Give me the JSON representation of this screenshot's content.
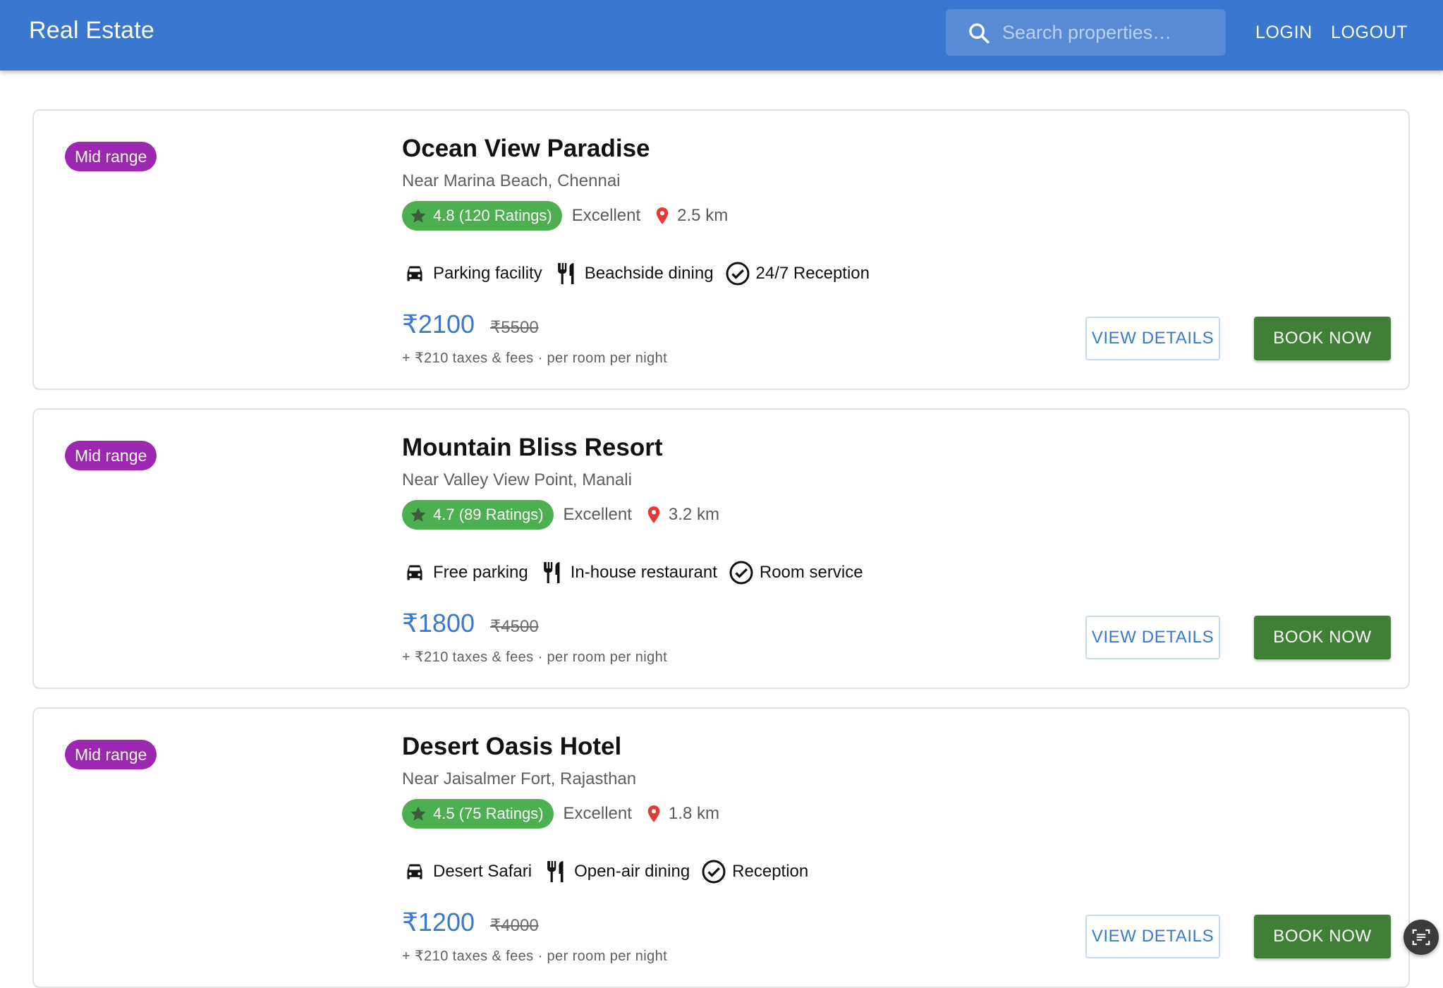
{
  "appbar": {
    "brand": "Real Estate",
    "search_placeholder": "Search properties…",
    "login_label": "LOGIN",
    "logout_label": "LOGOUT"
  },
  "colors": {
    "appbar": "#3a77cf",
    "tag": "#9c27b0",
    "rating": "#4caf50",
    "price": "#3a77cf",
    "book_button": "#3f7f36",
    "pin": "#e53935"
  },
  "listings": [
    {
      "tag": "Mid range",
      "name": "Ocean View Paradise",
      "address": "Near Marina Beach, Chennai",
      "rating": "4.8 (120 Ratings)",
      "quality": "Excellent",
      "distance": "2.5 km",
      "amenities": [
        {
          "icon": "car-icon",
          "label": "Parking facility"
        },
        {
          "icon": "restaurant-icon",
          "label": "Beachside dining"
        },
        {
          "icon": "check-circle-icon",
          "label": "24/7 Reception"
        }
      ],
      "price": "₹2100",
      "original_price": "₹5500",
      "fees": "+ ₹210 taxes & fees · per room per night",
      "view_label": "VIEW DETAILS",
      "book_label": "BOOK NOW"
    },
    {
      "tag": "Mid range",
      "name": "Mountain Bliss Resort",
      "address": "Near Valley View Point, Manali",
      "rating": "4.7 (89 Ratings)",
      "quality": "Excellent",
      "distance": "3.2 km",
      "amenities": [
        {
          "icon": "car-icon",
          "label": "Free parking"
        },
        {
          "icon": "restaurant-icon",
          "label": "In-house restaurant"
        },
        {
          "icon": "check-circle-icon",
          "label": "Room service"
        }
      ],
      "price": "₹1800",
      "original_price": "₹4500",
      "fees": "+ ₹210 taxes & fees · per room per night",
      "view_label": "VIEW DETAILS",
      "book_label": "BOOK NOW"
    },
    {
      "tag": "Mid range",
      "name": "Desert Oasis Hotel",
      "address": "Near Jaisalmer Fort, Rajasthan",
      "rating": "4.5 (75 Ratings)",
      "quality": "Excellent",
      "distance": "1.8 km",
      "amenities": [
        {
          "icon": "car-icon",
          "label": "Desert Safari"
        },
        {
          "icon": "restaurant-icon",
          "label": "Open-air dining"
        },
        {
          "icon": "check-circle-icon",
          "label": "Reception"
        }
      ],
      "price": "₹1200",
      "original_price": "₹4000",
      "fees": "+ ₹210 taxes & fees · per room per night",
      "view_label": "VIEW DETAILS",
      "book_label": "BOOK NOW"
    }
  ]
}
